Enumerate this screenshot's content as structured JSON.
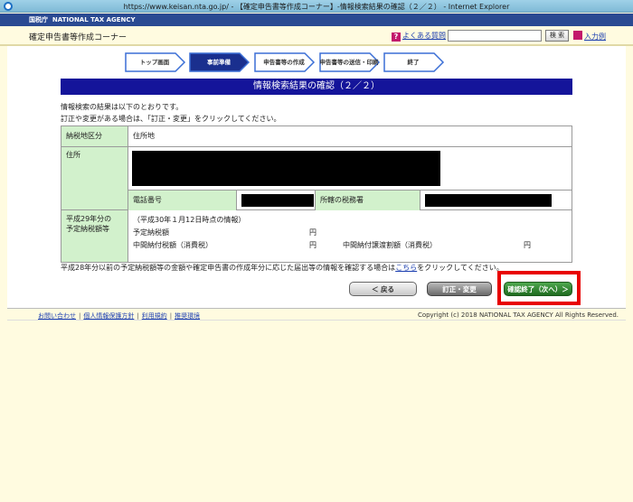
{
  "window": {
    "title": "https://www.keisan.nta.go.jp/ - 【確定申告書等作成コーナー】-情報検索結果の確認（２／２） - Internet Explorer"
  },
  "agency": {
    "logo": "国税庁",
    "name": "NATIONAL TAX AGENCY"
  },
  "header": {
    "corner_name": "確定申告書等作成コーナー",
    "faq_label": "よくある質問",
    "search_placeholder": "",
    "search_button": "検 索",
    "example_label": "入力例"
  },
  "steps": [
    {
      "label": "トップ画面",
      "active": false
    },
    {
      "label": "事前準備",
      "active": true
    },
    {
      "label": "申告書等の作成",
      "active": false
    },
    {
      "label": "申告書等の送信・印刷",
      "active": false
    },
    {
      "label": "終了",
      "active": false
    }
  ],
  "page": {
    "heading": "情報検索結果の確認（２／２）",
    "intro_line1": "情報検索の結果は以下のとおりです。",
    "intro_line2": "訂正や変更がある場合は、「訂正・変更」をクリックしてください。"
  },
  "table": {
    "tax_location_label": "納税地区分",
    "tax_location_value": "住所地",
    "address_label": "住所",
    "phone_label": "電話番号",
    "tax_office_label": "所轄の税務署",
    "prepay_label_line1": "平成29年分の",
    "prepay_label_line2": "予定納税額等",
    "prepay_as_of": "（平成30年１月12日時点の情報）",
    "prepay_amount_label": "予定納税額",
    "interim_consumption_label": "中間納付税額（消費税）",
    "interim_transfer_label": "中間納付譲渡割額（消費税）",
    "yen": "円"
  },
  "note": {
    "text_before": "平成28年分以前の予定納税額等の金額や確定申告書の作成年分に応じた届出等の情報を確認する場合は",
    "link": "こちら",
    "text_after": "をクリックしてください。"
  },
  "buttons": {
    "back": "＜ 戻る",
    "edit": "訂正・変更",
    "next": "確認終了（次へ）＞"
  },
  "footer": {
    "links": [
      "お問い合わせ",
      "個人情報保護方針",
      "利用規約",
      "推奨環境"
    ],
    "copyright": "Copyright (c) 2018 NATIONAL TAX AGENCY All Rights Reserved."
  },
  "colors": {
    "agency_bar": "#2a4a92",
    "heading_bg": "#14149a",
    "label_bg": "#d2f1cc",
    "highlight": "#e80000",
    "next_button": "#2e8b2e"
  }
}
